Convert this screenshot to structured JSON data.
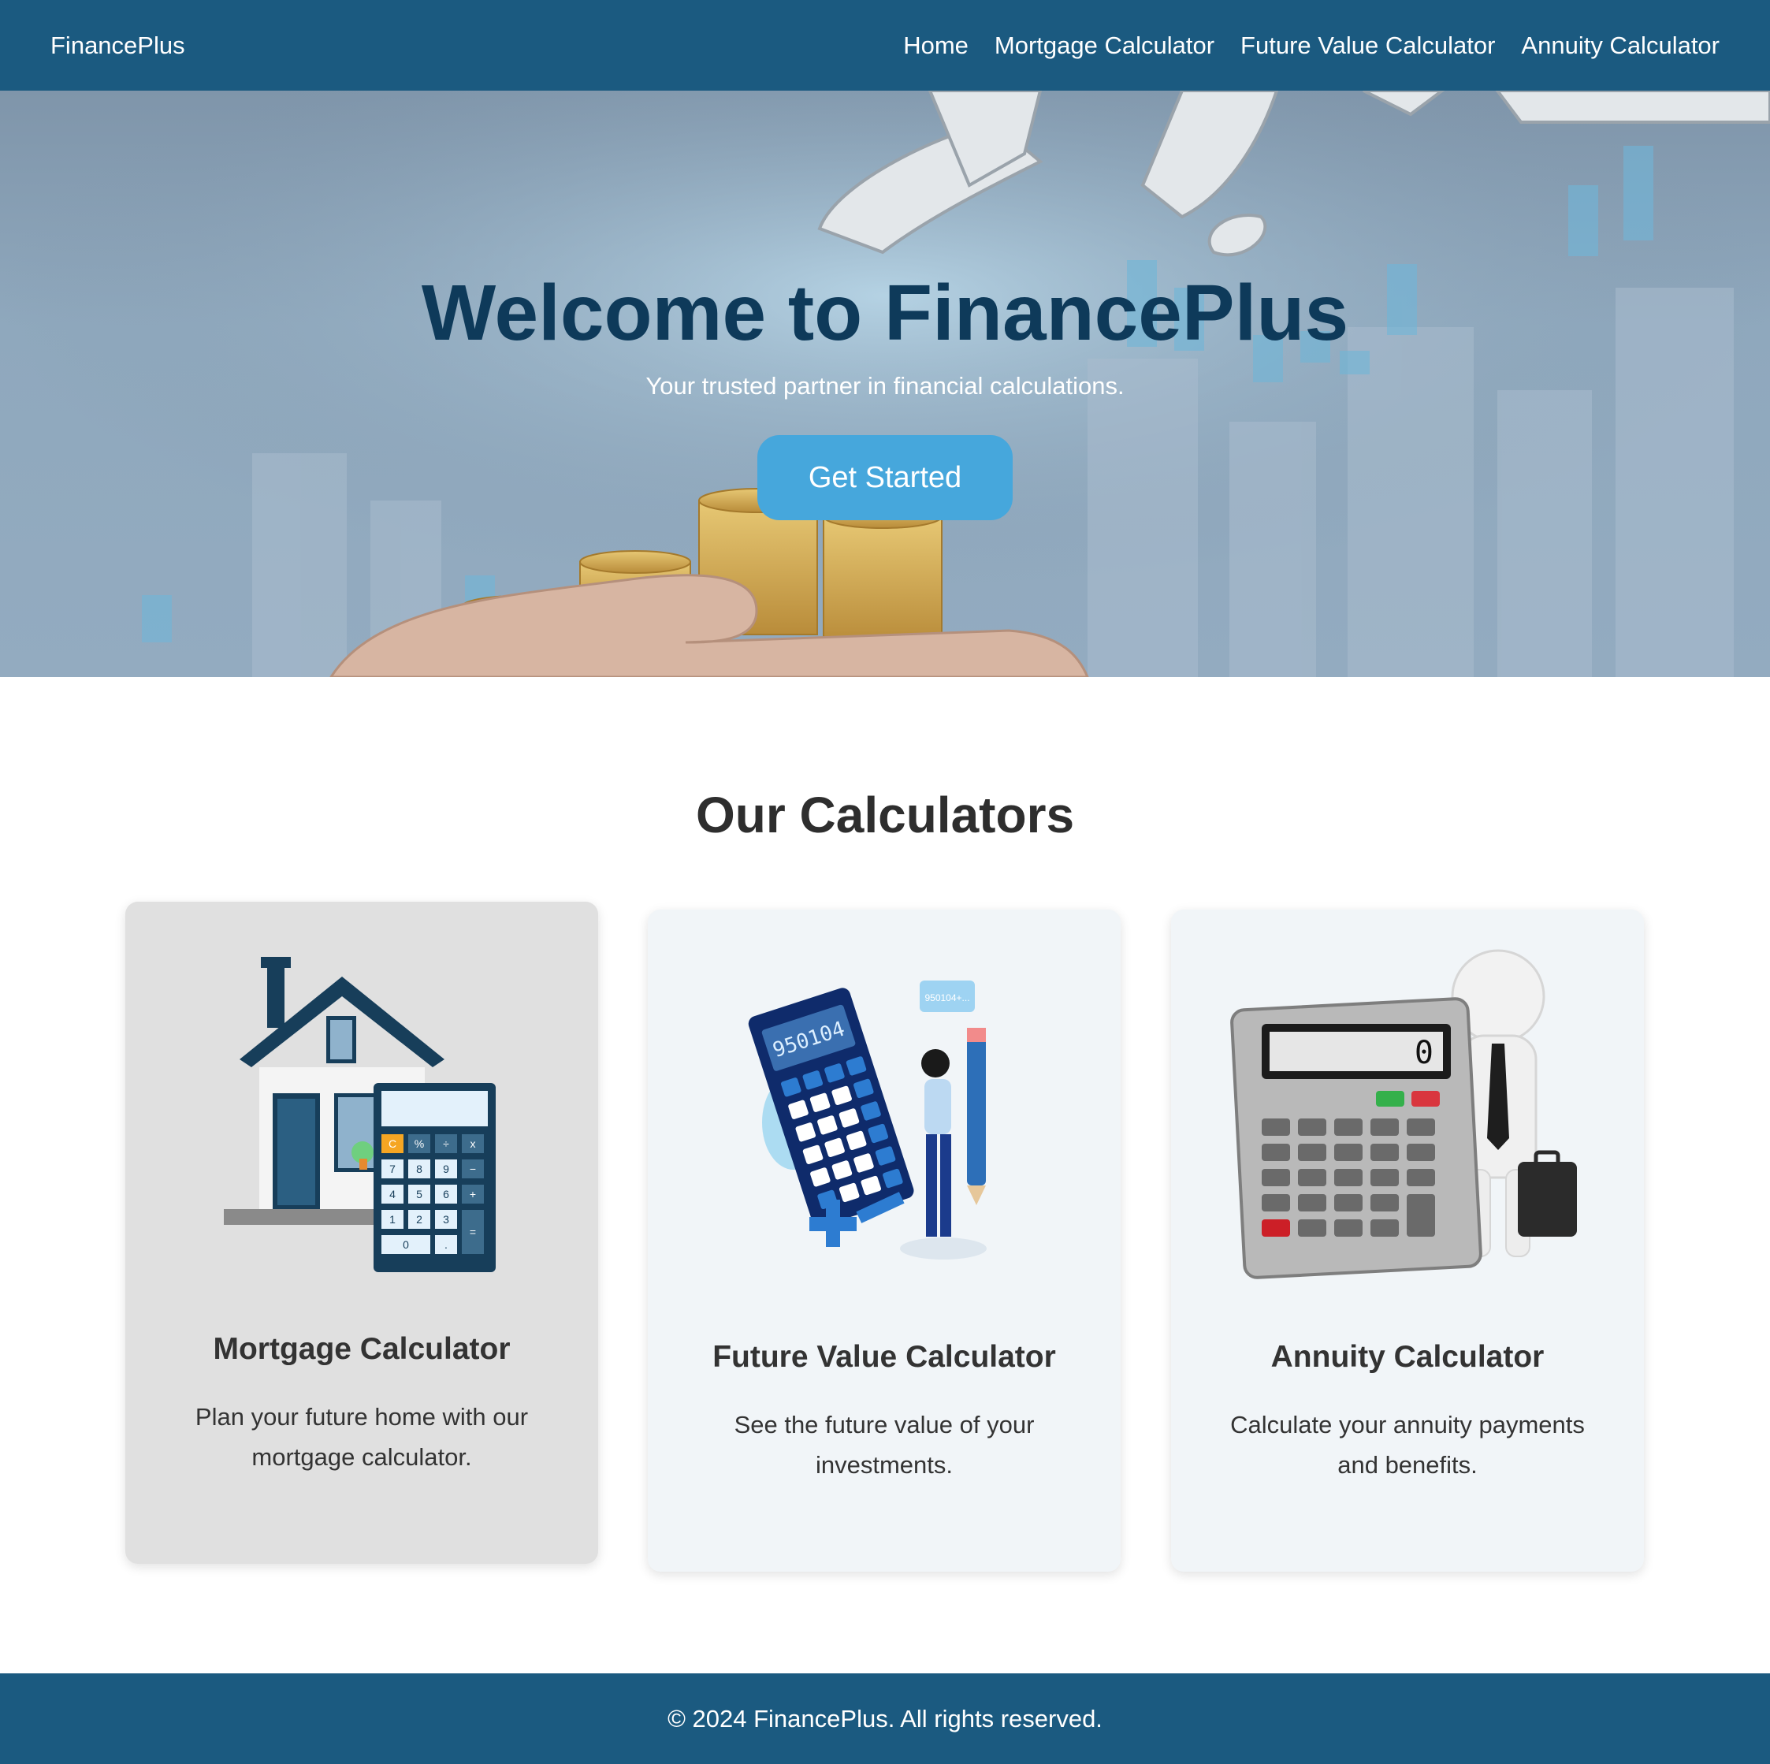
{
  "nav": {
    "brand": "FinancePlus",
    "links": [
      "Home",
      "Mortgage Calculator",
      "Future Value Calculator",
      "Annuity Calculator"
    ]
  },
  "hero": {
    "title": "Welcome to FinancePlus",
    "subtitle": "Your trusted partner in financial calculations.",
    "cta_label": "Get Started"
  },
  "calculators": {
    "section_title": "Our Calculators",
    "cards": [
      {
        "title": "Mortgage Calculator",
        "description": "Plan your future home with our mortgage calculator.",
        "icon": "house-calculator-illustration"
      },
      {
        "title": "Future Value Calculator",
        "description": "See the future value of your investments.",
        "icon": "person-calculator-illustration",
        "display": "950104",
        "bubble": "950104+..."
      },
      {
        "title": "Annuity Calculator",
        "description": "Calculate your annuity payments and benefits.",
        "icon": "businessman-calculator-illustration",
        "display": "0"
      }
    ]
  },
  "footer": {
    "text": "© 2024 FinancePlus. All rights reserved."
  },
  "colors": {
    "nav_bg": "#1b5a80",
    "cta": "#46a7dc",
    "hero_title": "#0e3a5a",
    "card_hover": "#e0e0e0",
    "card_bg": "#f1f5f8"
  }
}
